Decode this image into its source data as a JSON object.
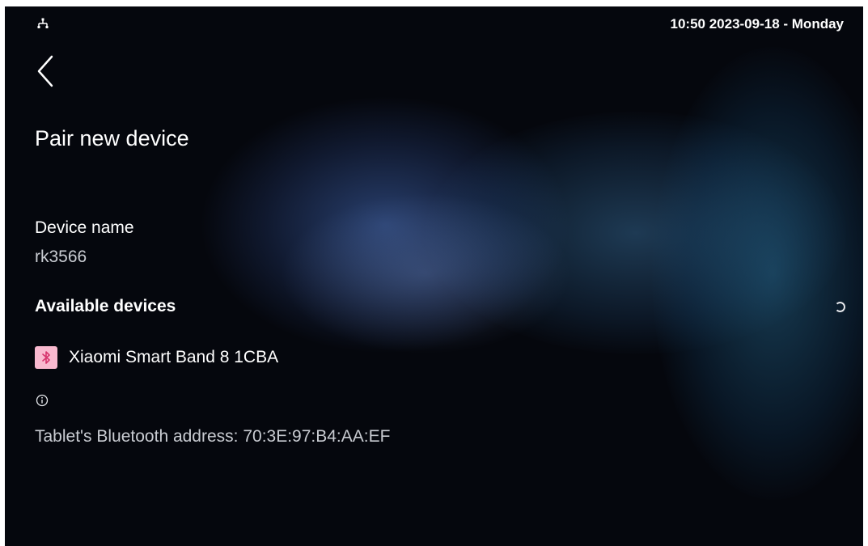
{
  "status_bar": {
    "network_icon": "network-tree-icon",
    "time_date": "10:50  2023-09-18 - Monday"
  },
  "nav": {
    "back_icon": "chevron-left-icon"
  },
  "page": {
    "title": "Pair new device"
  },
  "device": {
    "name_label": "Device name",
    "name_value": "rk3566"
  },
  "available": {
    "title": "Available devices",
    "spinner_icon": "loading-spinner-icon",
    "devices": [
      {
        "icon": "bluetooth-icon",
        "name": "Xiaomi Smart Band 8 1CBA"
      }
    ]
  },
  "footer": {
    "info_icon": "info-icon",
    "bt_address": "Tablet's Bluetooth address: 70:3E:97:B4:AA:EF"
  },
  "colors": {
    "background": "#05070d",
    "bluetooth_badge": "#f9b9cf",
    "bluetooth_glyph": "#d6336c",
    "text_primary": "#ffffff",
    "text_secondary": "#c9ccd2"
  }
}
